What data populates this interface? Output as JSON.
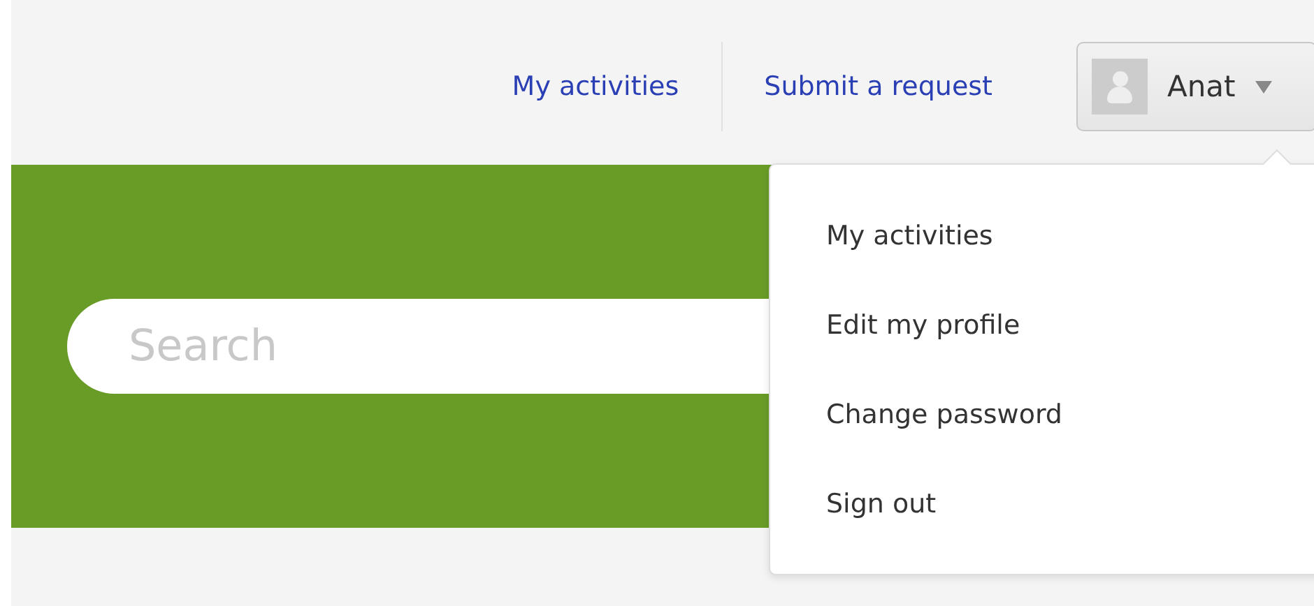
{
  "nav": [
    {
      "label": "My activities"
    },
    {
      "label": "Submit a request"
    }
  ],
  "user_menu": {
    "name": "Anat",
    "expanded": true,
    "items": [
      {
        "label": "My activities"
      },
      {
        "label": "Edit my profile"
      },
      {
        "label": "Change password"
      },
      {
        "label": "Sign out"
      }
    ]
  },
  "search": {
    "placeholder": "Search"
  }
}
